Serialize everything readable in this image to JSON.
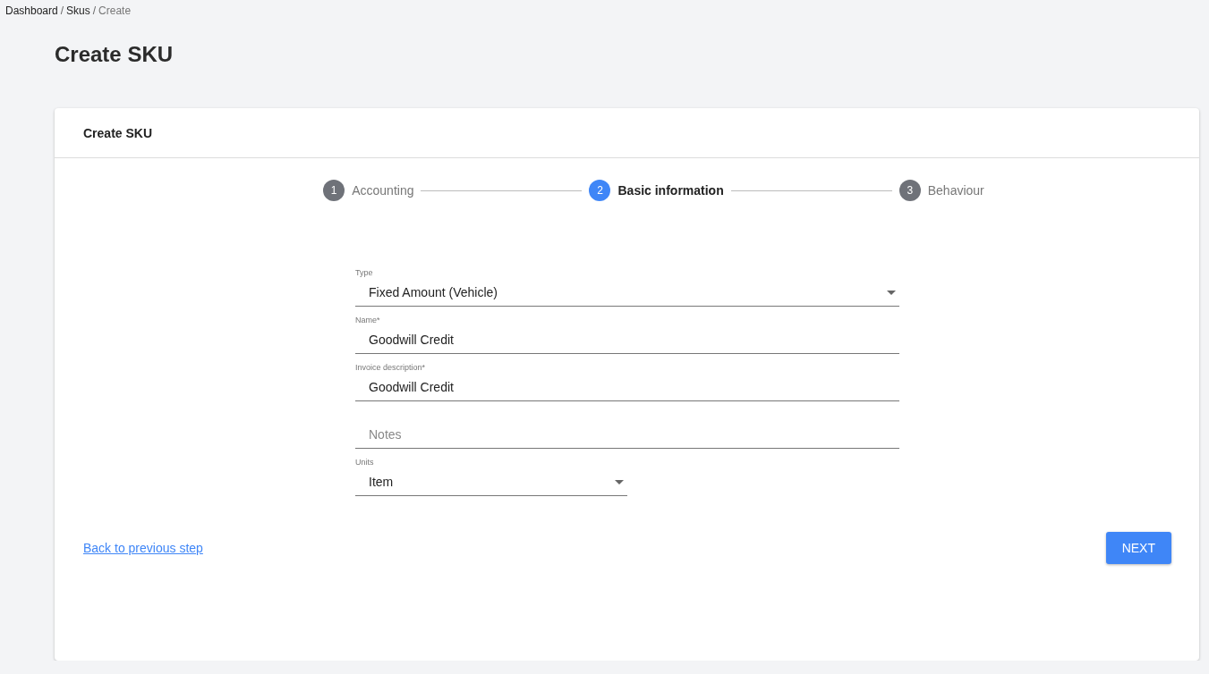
{
  "breadcrumb": [
    {
      "label": "Dashboard",
      "current": false
    },
    {
      "separator": "/",
      "label": "Skus",
      "current": false
    },
    {
      "separator": "/",
      "label": "Create",
      "current": true
    }
  ],
  "page_title": "Create SKU",
  "card": {
    "title": "Create SKU",
    "steps": [
      {
        "number": "1",
        "label": "Accounting",
        "selected": false
      },
      {
        "number": "2",
        "label": "Basic information",
        "selected": true
      },
      {
        "number": "3",
        "label": "Behaviour",
        "selected": false
      }
    ],
    "fields": [
      {
        "kind": "select",
        "label": "Type",
        "value": "Fixed Amount (Vehicle)"
      },
      {
        "kind": "text",
        "label": "Name*",
        "value": "Goodwill Credit"
      },
      {
        "kind": "text",
        "label": "Invoice description*",
        "value": "Goodwill Credit"
      },
      {
        "kind": "text",
        "placeholder": "Notes"
      },
      {
        "kind": "select",
        "label": "Units",
        "value": "Item"
      }
    ],
    "back_link": "Back to previous step",
    "next_button": "NEXT"
  }
}
